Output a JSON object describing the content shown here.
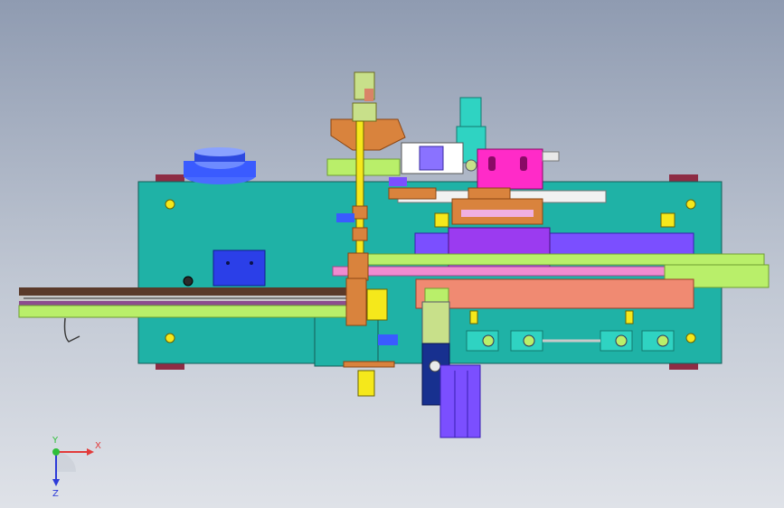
{
  "viewport": {
    "background_top": "#8f9bb1",
    "background_bottom": "#dfe2e8"
  },
  "model_colors": {
    "base_plate": "#1fb2a6",
    "rail_dark": "#5a3a2a",
    "rail_lime": "#b9ef6a",
    "slide_purple": "#7b4fff",
    "slide_pink": "#f08bd0",
    "block_salmon": "#f08a72",
    "cylinder_blue": "#3a5bff",
    "magenta_block": "#ff2bc8",
    "copper": "#d9833d",
    "bolt_yellow": "#f5e81b"
  },
  "triad": {
    "x_label": "X",
    "y_label": "Y",
    "z_label": "Z",
    "x_color": "#e23b3b",
    "y_color": "#2fbf3a",
    "z_color": "#2d3bd8"
  }
}
